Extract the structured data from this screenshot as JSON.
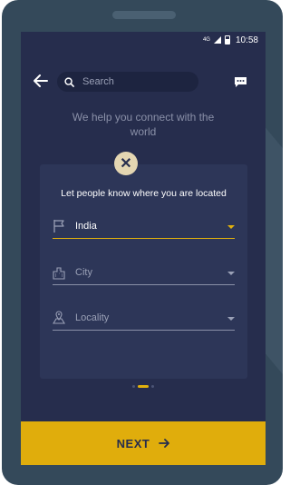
{
  "status_bar": {
    "network": "4G",
    "time": "10:58"
  },
  "header": {
    "search_placeholder": "Search",
    "back_icon": "arrow-left-icon",
    "search_icon": "search-icon",
    "chat_icon": "chat-bubble-icon"
  },
  "tagline": "We help you connect with the world",
  "card": {
    "title": "Let people know where you are located",
    "fields": [
      {
        "label": "India",
        "icon": "flag-icon",
        "placeholder": false
      },
      {
        "label": "City",
        "icon": "city-icon",
        "placeholder": true
      },
      {
        "label": "Locality",
        "icon": "map-pin-icon",
        "placeholder": true
      }
    ]
  },
  "pager": {
    "pages": 3,
    "current": 2
  },
  "next_label": "NEXT",
  "colors": {
    "background": "#262d4d",
    "card": "#2d3658",
    "accent": "#e0ad0c"
  }
}
